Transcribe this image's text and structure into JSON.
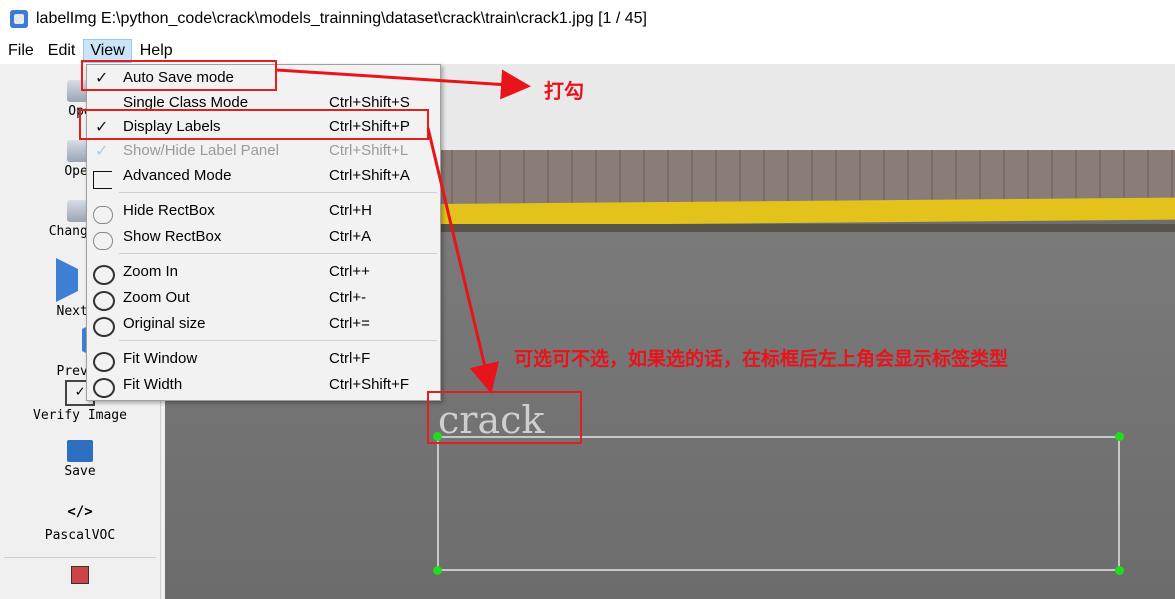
{
  "window": {
    "title": "labelImg E:\\python_code\\crack\\models_trainning\\dataset\\crack\\train\\crack1.jpg [1 / 45]"
  },
  "menubar": {
    "items": [
      "File",
      "Edit",
      "View",
      "Help"
    ],
    "active": "View"
  },
  "toolbar": {
    "items": [
      {
        "label": "Ope",
        "icon": "folder-icon"
      },
      {
        "label": "Open",
        "icon": "folder-icon"
      },
      {
        "label": "Change S",
        "icon": "folder-icon"
      },
      {
        "label": "Next I",
        "icon": "arrow-right-icon"
      },
      {
        "label": "Prev I",
        "icon": "arrow-left-icon"
      },
      {
        "label": "Verify Image",
        "icon": "checkbox-icon"
      },
      {
        "label": "Save",
        "icon": "floppy-icon"
      },
      {
        "label": "PascalVOC",
        "icon": "code-icon",
        "glyph": "</>"
      }
    ]
  },
  "view_menu": {
    "items": [
      {
        "label": "Auto Save mode",
        "shortcut": "",
        "checked": true
      },
      {
        "label": "Single Class Mode",
        "shortcut": "Ctrl+Shift+S",
        "checked": false
      },
      {
        "label": "Display Labels",
        "shortcut": "Ctrl+Shift+P",
        "checked": true
      },
      {
        "label": "Show/Hide Label Panel",
        "shortcut": "Ctrl+Shift+L",
        "checked": true,
        "disabled": true
      },
      {
        "label": "Advanced Mode",
        "shortcut": "Ctrl+Shift+A",
        "icon": "tag-icon"
      },
      {
        "label": "Hide RectBox",
        "shortcut": "Ctrl+H",
        "icon": "eye-icon"
      },
      {
        "label": "Show RectBox",
        "shortcut": "Ctrl+A",
        "icon": "eye-icon"
      },
      {
        "label": "Zoom In",
        "shortcut": "Ctrl++",
        "icon": "zoom-in-icon"
      },
      {
        "label": "Zoom Out",
        "shortcut": "Ctrl+-",
        "icon": "zoom-out-icon"
      },
      {
        "label": "Original size",
        "shortcut": "Ctrl+=",
        "icon": "zoom-original-icon"
      },
      {
        "label": "Fit Window",
        "shortcut": "Ctrl+F",
        "icon": "fit-window-icon"
      },
      {
        "label": "Fit Width",
        "shortcut": "Ctrl+Shift+F",
        "icon": "fit-width-icon"
      }
    ]
  },
  "canvas": {
    "box_label": "crack"
  },
  "annotations": {
    "tick_note": "打勾",
    "optional_note": "可选可不选，如果选的话，在标框后左上角会显示标签类型",
    "color": "#e8141b"
  }
}
